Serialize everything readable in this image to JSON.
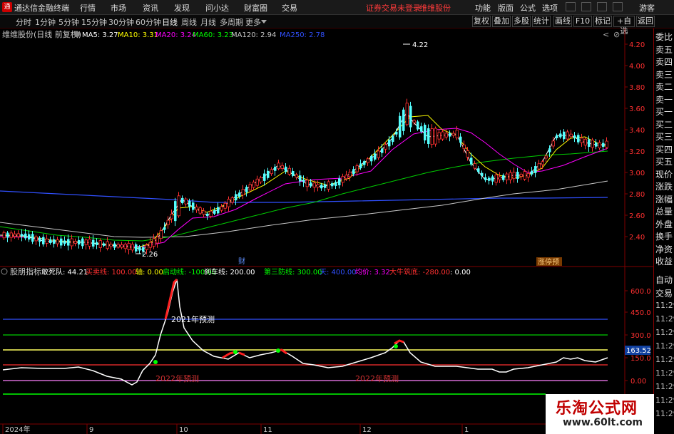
{
  "app": {
    "title": "通达信金融终端",
    "menu": [
      "行情",
      "市场",
      "资讯",
      "发现",
      "问小达",
      "财富圈",
      "交易"
    ],
    "status_text": "证券交易未登录",
    "stock_name": "维维股份",
    "right_menu": [
      "功能",
      "版面",
      "公式",
      "选项"
    ],
    "user": "游客"
  },
  "periods": [
    "分时",
    "1分钟",
    "5分钟",
    "15分钟",
    "30分钟",
    "60分钟",
    "日线",
    "周线",
    "月线",
    "多周期",
    "更多"
  ],
  "selected_period": "日线",
  "toolbar": [
    "复权",
    "叠加",
    "多股",
    "统计",
    "画线",
    "F10",
    "标记",
    "+自选",
    "返回"
  ],
  "main_chart": {
    "title": "维维股份(日线 前复权)",
    "ma_legend": [
      {
        "label": "MA5: 3.27",
        "color": "#ffffff"
      },
      {
        "label": "MA10: 3.31",
        "color": "#ffff00"
      },
      {
        "label": "MA20: 3.24",
        "color": "#ff00ff"
      },
      {
        "label": "MA60: 3.23",
        "color": "#00ff00"
      },
      {
        "label": "MA120: 2.94",
        "color": "#c8c8c8"
      },
      {
        "label": "MA250: 2.78",
        "color": "#3050ff"
      }
    ],
    "y_ticks": [
      "4.20",
      "4.00",
      "3.80",
      "3.60",
      "3.40",
      "3.20",
      "3.00",
      "2.80",
      "2.60",
      "2.40"
    ],
    "high_label": "4.22",
    "low_label": "2.26",
    "tag_cai": "财",
    "tag_zt": "涨停预"
  },
  "indicator": {
    "name": "股朋指标",
    "legend": [
      {
        "label": "敢死队: 44.21",
        "color": "#ffffff"
      },
      {
        "label": "买卖线: 100.00",
        "color": "#ff3030"
      },
      {
        "label": "轴: 0.00",
        "color": "#ffff00"
      },
      {
        "label": "启动线: -100.00",
        "color": "#00ff00"
      },
      {
        "label": "刹车线: 200.00",
        "color": "#ffffff"
      },
      {
        "label": "第三防线: 300.00",
        "color": "#00ff00"
      },
      {
        "label": "天: 400.00",
        "color": "#3050ff"
      },
      {
        "label": "均价: 3.32",
        "color": "#ff00ff"
      },
      {
        "label": "大牛筑底: -280.00",
        "color": "#ff3030"
      },
      {
        "label": ": 0.00",
        "color": "#ffffff"
      }
    ],
    "y_ticks": [
      "600.0",
      "450.0",
      "300.0",
      "150.0",
      "0.00"
    ],
    "current_value": "163.52",
    "annotation_2021": "2021年预测",
    "annotation_2022a": "2022年预测",
    "annotation_2022b": "2022年预测"
  },
  "x_axis": [
    "2024年",
    "9",
    "10",
    "11",
    "12",
    "1"
  ],
  "right_panel": {
    "items": [
      "委比",
      "卖五",
      "卖四",
      "卖三",
      "卖二",
      "卖一",
      "买一",
      "买二",
      "买三",
      "买四",
      "买五",
      "现价",
      "涨跌",
      "涨幅",
      "总量",
      "外盘",
      "换手",
      "净资",
      "收益"
    ],
    "lower": [
      "自动",
      "交易",
      "11:29",
      "11:29",
      "11:29",
      "11:29",
      "11:29",
      "11:29",
      "11:29",
      "11:29",
      "11:29"
    ]
  },
  "watermark": {
    "line1": "乐淘公式网",
    "line2": "www.60lt.com"
  }
}
